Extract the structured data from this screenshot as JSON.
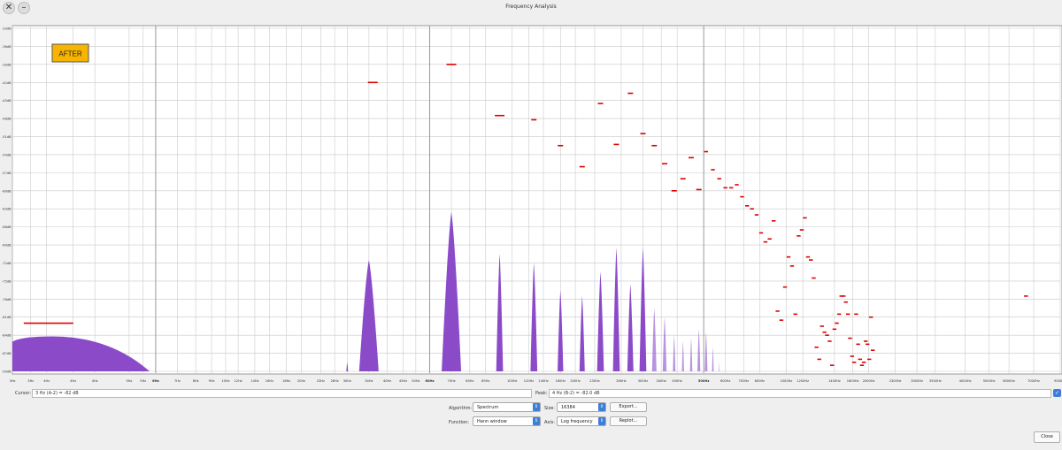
{
  "window": {
    "title": "Frequency Analysis",
    "close_icon": "close-icon",
    "minimize_icon": "minimize-icon"
  },
  "overlay_label": "AFTER",
  "chart_data": {
    "type": "area",
    "x_scale": "log",
    "x_range": [
      3,
      20000
    ],
    "y_range": [
      -90,
      -33
    ],
    "y_tick_values": [
      -33,
      -36,
      -39,
      -42,
      -45,
      -48,
      -51,
      -54,
      -57,
      -60,
      -63,
      -66,
      -69,
      -72,
      -75,
      -78,
      -81,
      -84,
      -87,
      -90
    ],
    "y_tick_labels": [
      "-33dB",
      "-36dB",
      "-39dB",
      "-42dB",
      "-45dB",
      "-48dB",
      "-51dB",
      "-54dB",
      "-57dB",
      "-60dB",
      "-63dB",
      "-66dB",
      "-69dB",
      "-72dB",
      "-75dB",
      "-78dB",
      "-81dB",
      "-84dB",
      "-87dB",
      "-90dB"
    ],
    "x_tick_values": [
      3,
      3.5,
      4,
      5,
      6,
      8,
      9,
      10,
      12,
      14,
      16,
      18,
      20,
      23,
      26,
      30,
      34,
      40,
      45,
      50,
      60,
      70,
      80,
      89,
      100,
      120,
      140,
      160,
      200,
      230,
      260,
      300,
      340,
      400,
      500,
      600,
      700,
      800,
      1000,
      1200,
      1400,
      1600,
      2000,
      2300,
      3000,
      3500,
      4000,
      5000,
      6000,
      7000,
      9000,
      11000,
      13000,
      16000,
      20000
    ],
    "x_tick_labels": [
      "3Hz",
      "3Hz",
      "4Hz",
      "4Hz",
      "4Hz",
      "5Hz",
      "5Hz",
      "6Hz",
      "7Hz",
      "8Hz",
      "9Hz",
      "10Hz",
      "12Hz",
      "14Hz",
      "16Hz",
      "18Hz",
      "20Hz",
      "23Hz",
      "26Hz",
      "30Hz",
      "34Hz",
      "40Hz",
      "45Hz",
      "50Hz",
      "60Hz",
      "70Hz",
      "80Hz",
      "89Hz",
      "100Hz",
      "120Hz",
      "140Hz",
      "160Hz",
      "200Hz",
      "230Hz",
      "260Hz",
      "300Hz",
      "340Hz",
      "400Hz",
      "500Hz",
      "600Hz",
      "700Hz",
      "800Hz",
      "1000Hz",
      "1200Hz",
      "1400Hz",
      "1600Hz",
      "2000Hz",
      "2300Hz",
      "3000Hz",
      "3500Hz",
      "4000Hz",
      "5000Hz",
      "6000Hz",
      "7000Hz",
      "9000Hz",
      "11000Hz",
      "13000Hz",
      "16000Hz",
      "20000Hz"
    ],
    "fill_color": "#8b4bc9",
    "marker_color": "#e00000",
    "grid": true,
    "spectrum_hill": {
      "start_hz": 3,
      "peak_hz": 4.2,
      "end_hz": 9.5,
      "peak_db": -84.2,
      "floor_db": -90
    },
    "spectrum_peaks": [
      {
        "hz": 50,
        "db": -88.5
      },
      {
        "hz": 60,
        "db": -71.5
      },
      {
        "hz": 120,
        "db": -63.5
      },
      {
        "hz": 180,
        "db": -70.5
      },
      {
        "hz": 240,
        "db": -72.0
      },
      {
        "hz": 300,
        "db": -76.5
      },
      {
        "hz": 360,
        "db": -77.5
      },
      {
        "hz": 420,
        "db": -73.5
      },
      {
        "hz": 480,
        "db": -69.5
      },
      {
        "hz": 540,
        "db": -75.5
      },
      {
        "hz": 600,
        "db": -69.5
      },
      {
        "hz": 660,
        "db": -79.5
      },
      {
        "hz": 720,
        "db": -81.0
      },
      {
        "hz": 780,
        "db": -84.0
      },
      {
        "hz": 840,
        "db": -85.0
      },
      {
        "hz": 900,
        "db": -84.5
      },
      {
        "hz": 960,
        "db": -83.0
      },
      {
        "hz": 1020,
        "db": -83.5
      },
      {
        "hz": 1080,
        "db": -86.0
      },
      {
        "hz": 1140,
        "db": -88.5
      }
    ],
    "peak_markers": [
      {
        "hz": 3.3,
        "hz2": 5.0,
        "db": -82.0
      },
      {
        "hz": 62,
        "db": -42.0
      },
      {
        "hz": 120,
        "db": -39.0
      },
      {
        "hz": 180,
        "db": -47.5
      },
      {
        "hz": 240,
        "db": -48.2
      },
      {
        "hz": 300,
        "db": -52.5
      },
      {
        "hz": 360,
        "db": -56.0
      },
      {
        "hz": 420,
        "db": -45.5
      },
      {
        "hz": 480,
        "db": -52.3
      },
      {
        "hz": 540,
        "db": -43.8
      },
      {
        "hz": 600,
        "db": -50.5
      },
      {
        "hz": 660,
        "db": -52.5
      },
      {
        "hz": 720,
        "db": -55.5
      },
      {
        "hz": 780,
        "db": -60.0
      },
      {
        "hz": 840,
        "db": -58.0
      },
      {
        "hz": 900,
        "db": -54.5
      },
      {
        "hz": 960,
        "db": -59.8
      },
      {
        "hz": 1020,
        "db": -53.5
      },
      {
        "hz": 1080,
        "db": -56.5
      },
      {
        "hz": 1140,
        "db": -58.0
      },
      {
        "hz": 1200,
        "db": -59.5
      },
      {
        "hz": 1260,
        "db": -59.5
      },
      {
        "hz": 1320,
        "db": -59.0
      },
      {
        "hz": 1380,
        "db": -61.0
      },
      {
        "hz": 1440,
        "db": -62.5
      },
      {
        "hz": 1500,
        "db": -63.0
      },
      {
        "hz": 1560,
        "db": -64.0
      },
      {
        "hz": 1620,
        "db": -67.0
      },
      {
        "hz": 1680,
        "db": -68.5
      },
      {
        "hz": 1740,
        "db": -68.0
      },
      {
        "hz": 1800,
        "db": -65.0
      },
      {
        "hz": 1860,
        "db": -80.0
      },
      {
        "hz": 1920,
        "db": -81.5
      },
      {
        "hz": 1980,
        "db": -76.0
      },
      {
        "hz": 2040,
        "db": -71.0
      },
      {
        "hz": 2100,
        "db": -72.5
      },
      {
        "hz": 2160,
        "db": -80.5
      },
      {
        "hz": 2220,
        "db": -67.5
      },
      {
        "hz": 2280,
        "db": -66.5
      },
      {
        "hz": 2340,
        "db": -64.5
      },
      {
        "hz": 2400,
        "db": -71.0
      },
      {
        "hz": 2460,
        "db": -71.5
      },
      {
        "hz": 2520,
        "db": -74.5
      },
      {
        "hz": 2580,
        "db": -86.0
      },
      {
        "hz": 2640,
        "db": -88.0
      },
      {
        "hz": 2700,
        "db": -82.5
      },
      {
        "hz": 2760,
        "db": -83.5
      },
      {
        "hz": 2820,
        "db": -84.0
      },
      {
        "hz": 2880,
        "db": -85.0
      },
      {
        "hz": 2940,
        "db": -89.0
      },
      {
        "hz": 3000,
        "db": -83.0
      },
      {
        "hz": 3060,
        "db": -82.0
      },
      {
        "hz": 3120,
        "db": -80.5
      },
      {
        "hz": 3180,
        "db": -77.5
      },
      {
        "hz": 3240,
        "db": -77.5
      },
      {
        "hz": 3300,
        "db": -78.5
      },
      {
        "hz": 3360,
        "db": -80.5
      },
      {
        "hz": 3420,
        "db": -84.5
      },
      {
        "hz": 3480,
        "db": -87.5
      },
      {
        "hz": 3540,
        "db": -88.5
      },
      {
        "hz": 3600,
        "db": -80.5
      },
      {
        "hz": 3660,
        "db": -85.5
      },
      {
        "hz": 3720,
        "db": -88.0
      },
      {
        "hz": 3780,
        "db": -89.0
      },
      {
        "hz": 3840,
        "db": -88.5
      },
      {
        "hz": 3900,
        "db": -85.0
      },
      {
        "hz": 3960,
        "db": -85.5
      },
      {
        "hz": 4020,
        "db": -88.0
      },
      {
        "hz": 4080,
        "db": -81.0
      },
      {
        "hz": 4140,
        "db": -86.5
      },
      {
        "hz": 15000,
        "db": -77.5
      }
    ]
  },
  "controls": {
    "cursor_label": "Cursor:",
    "cursor_value": "3 Hz (A-2) = -82 dB",
    "peak_label": "Peak:",
    "peak_value": "4 Hz (B-2) = -82.0 dB",
    "algorithm_label": "Algorithm:",
    "algorithm_value": "Spectrum",
    "size_label": "Size:",
    "size_value": "16384",
    "function_label": "Function:",
    "function_value": "Hann window",
    "axis_label": "Axis:",
    "axis_value": "Log frequency",
    "export_label": "Export...",
    "replot_label": "Replot...",
    "close_label": "Close",
    "grids_checked": true,
    "check_icon": "check-icon",
    "dropdown_icon": "dropdown-arrow-icon"
  }
}
